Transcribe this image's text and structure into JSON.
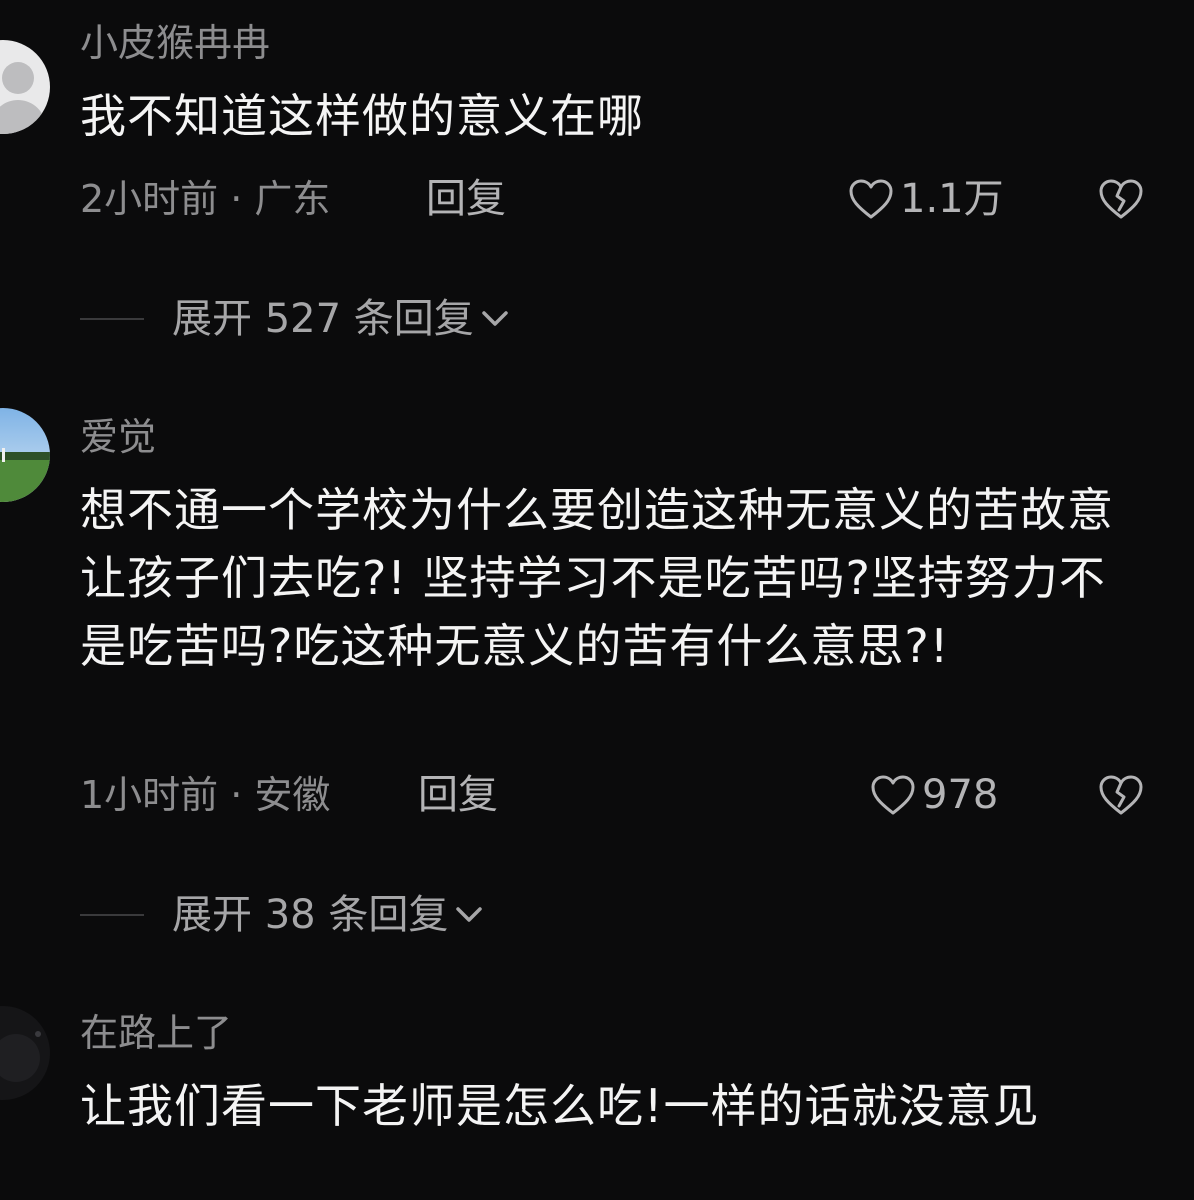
{
  "comments": [
    {
      "username": "小皮猴冉冉",
      "text": "我不知道这样做的意义在哪",
      "meta": "2小时前 · 广东",
      "reply_label": "回复",
      "likes": "1.1万",
      "expand_label": "展开 527 条回复"
    },
    {
      "username": "爱觉",
      "text": "想不通一个学校为什么要创造这种无意义的苦故意让孩子们去吃?! 坚持学习不是吃苦吗?坚持努力不是吃苦吗?吃这种无意义的苦有什么意思?!",
      "meta": "1小时前 · 安徽",
      "reply_label": "回复",
      "likes": "978",
      "expand_label": "展开 38 条回复"
    },
    {
      "username": "在路上了",
      "text": "让我们看一下老师是怎么吃!一样的话就没意见"
    }
  ]
}
